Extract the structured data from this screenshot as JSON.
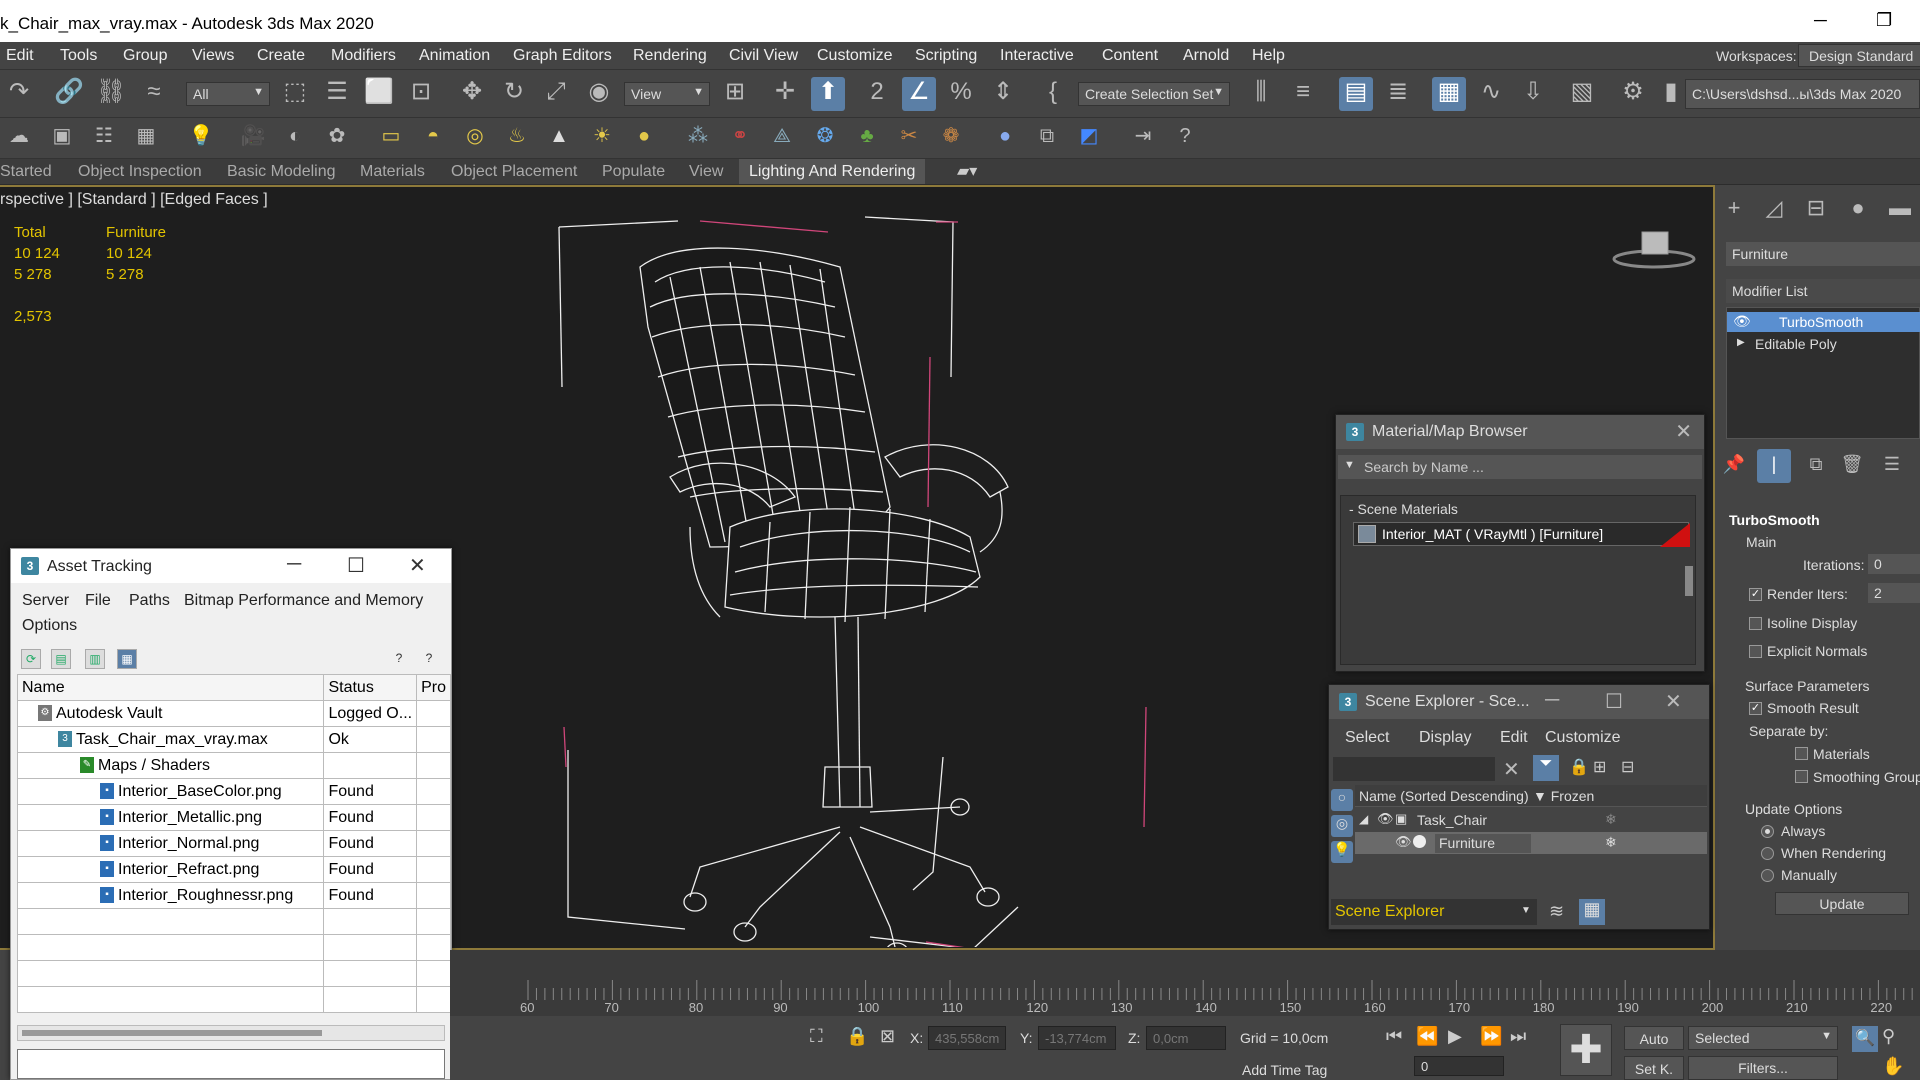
{
  "window": {
    "title": "k_Chair_max_vray.max - Autodesk 3ds Max 2020",
    "minimize": "─",
    "restore": "❐"
  },
  "menu": {
    "items": [
      "Edit",
      "Tools",
      "Group",
      "Views",
      "Create",
      "Modifiers",
      "Animation",
      "Graph Editors",
      "Rendering",
      "Civil View",
      "Customize",
      "Scripting",
      "Interactive",
      "Content",
      "Arnold",
      "Help"
    ],
    "workspaces_label": "Workspaces:",
    "workspace_value": "Design Standard"
  },
  "toolbar": {
    "filter_value": "All",
    "view_value": "View",
    "selection_set_placeholder": "Create Selection Set",
    "project_path": "C:\\Users\\dshsd...ы\\3ds Max 2020"
  },
  "ribbon": {
    "tabs": [
      "Started",
      "Object Inspection",
      "Basic Modeling",
      "Materials",
      "Object Placement",
      "Populate",
      "View",
      "Lighting And Rendering"
    ]
  },
  "viewport": {
    "label": "rspective ] [Standard ] [Edged Faces ]",
    "stats": {
      "col1_header": "Total",
      "col2_header": "Furniture",
      "polys_total": "10 124",
      "polys_sel": "10 124",
      "verts_total": "5 278",
      "verts_sel": "5 278",
      "fps": "2,573"
    }
  },
  "command_panel": {
    "object_name": "Furniture",
    "modifier_list_label": "Modifier List",
    "stack": [
      "TurboSmooth",
      "Editable Poly"
    ],
    "rollout_title": "TurboSmooth",
    "main_label": "Main",
    "iterations_label": "Iterations:",
    "iterations_value": "0",
    "render_iters_label": "Render Iters:",
    "render_iters_value": "2",
    "isoline_label": "Isoline Display",
    "explicit_normals_label": "Explicit Normals",
    "surface_params_label": "Surface Parameters",
    "smooth_result_label": "Smooth Result",
    "separate_by_label": "Separate by:",
    "materials_label": "Materials",
    "smoothing_groups_label": "Smoothing Groups",
    "update_options_label": "Update Options",
    "always_label": "Always",
    "when_rendering_label": "When Rendering",
    "manually_label": "Manually",
    "update_button": "Update"
  },
  "material_browser": {
    "title": "Material/Map Browser",
    "search_placeholder": "Search by Name ...",
    "group": "- Scene Materials",
    "material": "Interior_MAT  ( VRayMtl )  [Furniture]"
  },
  "scene_explorer": {
    "title": "Scene Explorer - Sce...",
    "menu": [
      "Select",
      "Display",
      "Edit",
      "Customize"
    ],
    "col_name": "Name (Sorted Descending)",
    "col_frozen": "▼ Frozen",
    "rows": [
      "Task_Chair",
      "Furniture"
    ],
    "footer_value": "Scene Explorer"
  },
  "asset_tracking": {
    "title": "Asset Tracking",
    "menu": [
      "Server",
      "File",
      "Paths",
      "Bitmap Performance and Memory",
      "Options"
    ],
    "columns": [
      "Name",
      "Status",
      "Pro"
    ],
    "rows": [
      {
        "name": "Autodesk Vault",
        "status": "Logged O..."
      },
      {
        "name": "Task_Chair_max_vray.max",
        "status": "Ok"
      },
      {
        "name": "Maps / Shaders",
        "status": ""
      },
      {
        "name": "Interior_BaseColor.png",
        "status": "Found"
      },
      {
        "name": "Interior_Metallic.png",
        "status": "Found"
      },
      {
        "name": "Interior_Normal.png",
        "status": "Found"
      },
      {
        "name": "Interior_Refract.png",
        "status": "Found"
      },
      {
        "name": "Interior_Roughnessr.png",
        "status": "Found"
      }
    ]
  },
  "timeline": {
    "ticks": [
      "60",
      "70",
      "80",
      "90",
      "100",
      "110",
      "120",
      "130",
      "140",
      "150",
      "160",
      "170",
      "180",
      "190",
      "200",
      "210",
      "220"
    ]
  },
  "status": {
    "x_label": "X:",
    "x_value": "435,558cm",
    "y_label": "Y:",
    "y_value": "-13,774cm",
    "z_label": "Z:",
    "z_value": "0,0cm",
    "grid": "Grid = 10,0cm",
    "add_time_tag": "Add Time Tag",
    "auto_key": "Auto",
    "set_key": "Set K.",
    "key_filter": "Selected",
    "filters": "Filters...",
    "frame": "0"
  }
}
